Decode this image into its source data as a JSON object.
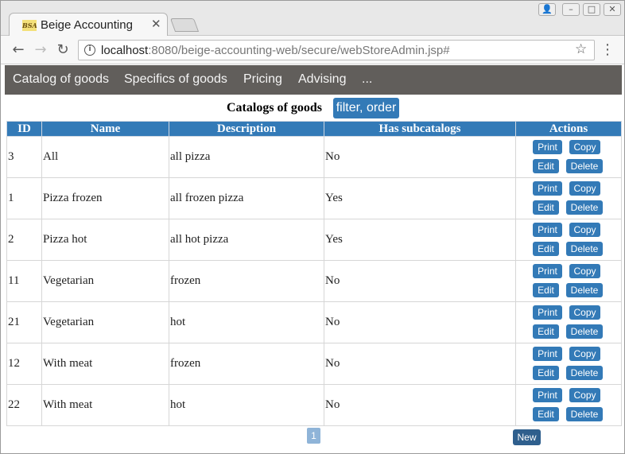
{
  "browser": {
    "tab_title": "Beige Accounting",
    "favicon_text": "BSA",
    "url_host": "localhost",
    "url_rest": ":8080/beige-accounting-web/secure/webStoreAdmin.jsp#"
  },
  "nav": {
    "items": [
      "Catalog of goods",
      "Specifics of goods",
      "Pricing",
      "Advising",
      "..."
    ]
  },
  "heading": {
    "title": "Catalogs of goods",
    "filter_label": "filter, order"
  },
  "table": {
    "headers": [
      "ID",
      "Name",
      "Description",
      "Has subcatalogs",
      "Actions"
    ],
    "rows": [
      {
        "id": "3",
        "name": "All",
        "description": "all pizza",
        "has_subcatalogs": "No"
      },
      {
        "id": "1",
        "name": "Pizza frozen",
        "description": "all frozen pizza",
        "has_subcatalogs": "Yes"
      },
      {
        "id": "2",
        "name": "Pizza hot",
        "description": "all hot pizza",
        "has_subcatalogs": "Yes"
      },
      {
        "id": "11",
        "name": "Vegetarian",
        "description": "frozen",
        "has_subcatalogs": "No"
      },
      {
        "id": "21",
        "name": "Vegetarian",
        "description": "hot",
        "has_subcatalogs": "No"
      },
      {
        "id": "12",
        "name": "With meat",
        "description": "frozen",
        "has_subcatalogs": "No"
      },
      {
        "id": "22",
        "name": "With meat",
        "description": "hot",
        "has_subcatalogs": "No"
      }
    ],
    "actions": {
      "print": "Print",
      "copy": "Copy",
      "edit": "Edit",
      "delete": "Delete"
    }
  },
  "pagination": {
    "current_page": "1"
  },
  "new_label": "New",
  "colors": {
    "nav_bg": "#615e5b",
    "accent": "#337ab7"
  }
}
